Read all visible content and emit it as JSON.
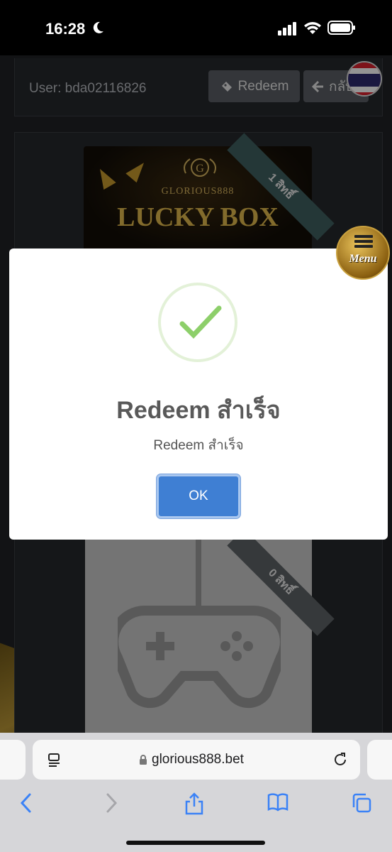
{
  "status_bar": {
    "time": "16:28"
  },
  "header": {
    "user_label": "User: bda02116826",
    "redeem_label": "Redeem",
    "back_label": "กลับ"
  },
  "cards": [
    {
      "brand": "GLORIOUS888",
      "title": "LUCKY BOX",
      "ribbon": "1 สิทธิ์"
    },
    {
      "ribbon": "0 สิทธิ์"
    }
  ],
  "menu": {
    "label": "Menu"
  },
  "modal": {
    "title": "Redeem สำเร็จ",
    "message": "Redeem สำเร็จ",
    "ok_label": "OK"
  },
  "browser": {
    "url": "glorious888.bet"
  },
  "colors": {
    "ok_button": "#3f7fd3",
    "success_check": "#8dcf6a",
    "ribbon": "#3e5f5f"
  }
}
